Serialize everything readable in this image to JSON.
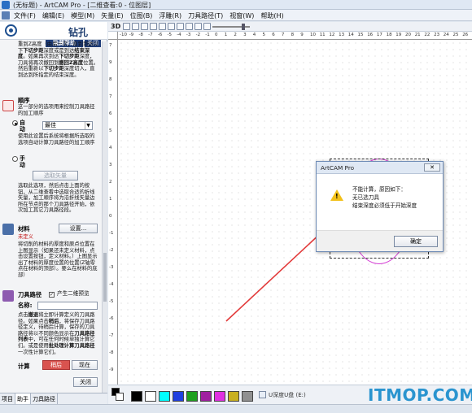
{
  "window": {
    "title": "(无标题) - ArtCAM Pro - [二维查看:0 - 位图层]"
  },
  "menu": {
    "items": [
      "文件(F)",
      "编辑(E)",
      "模型(M)",
      "矢量(E)",
      "位图(B)",
      "浮雕(R)",
      "刀具路径(T)",
      "视窗(W)",
      "帮助(H)"
    ]
  },
  "panel": {
    "title": "钻孔",
    "tabs": {
      "help": "隐藏帮助",
      "close": "关闭"
    },
    "intro_html": "重到Z高度（由后一次，直到到达以下<b>下切步距</b>深度或是到达<b>结束深度</b>。如果再次到达<b>下切步距</b>深度，刀具将再次撤回到<b>撤回Z高度</b>位置。然后重新以<b>下切步距</b>深度切入，直到达到所指定的结束深度。",
    "order_label": "顺序",
    "order_desc": "这一部分的选项用来控制刀具路径的加工顺序",
    "auto_radio": "自动",
    "order_select": "最佳",
    "order_note": "使用此设置后系统将根据所选取的选项自动计算刀具路径的加工顺序",
    "manual_radio": "手动",
    "select_vector_btn": "选取矢量",
    "select_note": "选取此选项，然后点击上面的按钮，从二维查看中选取合适的折线矢量，加工顺序将为沿折线矢量边所在节点的那个刀具路径开始，依次加工其它刀具路径段。",
    "material_label": "材料",
    "material_settings_btn": "设置...",
    "material_status": "未定义",
    "material_desc": "将切削的材料的厚度和原点位置在上图显示（如果还未定义材料，点击设置按钮，定义材料。）上图显示出了材料的厚度位置的位置(Z轴零点在材料的顶部）。要么在材料的底部）",
    "toolpath_label": "刀具路径",
    "preview_checkbox": "产生二维预览",
    "name_label": "名称:",
    "toolpath_note_html": "点击<b>撤退</b>将立即计算定义的刀具路径。如果点击<b>稍后</b>，将保存刀具路径定义，待稍后计算，保存的刀具路径将以不同颜色显示在<b>刀具路径列表</b>中，可在任何时候单独计算它们。或是使用<b>批处理计算刀具路径</b>一次性计算它们。",
    "calc_label": "计算",
    "later_btn": "稍后",
    "now_btn": "现在",
    "close_btn": "关闭"
  },
  "bottom_tabs": [
    "项目",
    "助手",
    "刀具路径"
  ],
  "toolbar": {
    "mode_3d": "3D"
  },
  "ruler": {
    "h_ticks": [
      "-10",
      "-9",
      "-8",
      "-7",
      "-6",
      "-5",
      "-4",
      "-3",
      "-2",
      "-1",
      "0",
      "1",
      "2",
      "3",
      "4",
      "5",
      "6",
      "7",
      "8",
      "9",
      "10",
      "11",
      "12",
      "13",
      "14",
      "15",
      "16",
      "17",
      "18",
      "19",
      "20",
      "21",
      "22",
      "23",
      "24",
      "25",
      "26"
    ],
    "v_ticks": [
      "7",
      "9",
      "8",
      "7",
      "6",
      "5",
      "4",
      "3",
      "2",
      "1",
      "0",
      "-1",
      "-2",
      "-3",
      "-4",
      "-5",
      "-6",
      "-7",
      "-8",
      "-9"
    ]
  },
  "dialog": {
    "title": "ArtCAM Pro",
    "close": "✕",
    "line1": "不能计算，原因如下：",
    "line2": "无已选刀具",
    "line3": "结束深度必须低于开始深度",
    "ok": "确定"
  },
  "palette": {
    "colors": [
      "#000000",
      "#ffffff",
      "#00ffff",
      "#2040e0",
      "#20a020",
      "#a020a0",
      "#e030e0",
      "#c8b020",
      "#909090"
    ],
    "status": "U深度U盘 (E:)"
  },
  "watermark": "ITMOP.COM"
}
